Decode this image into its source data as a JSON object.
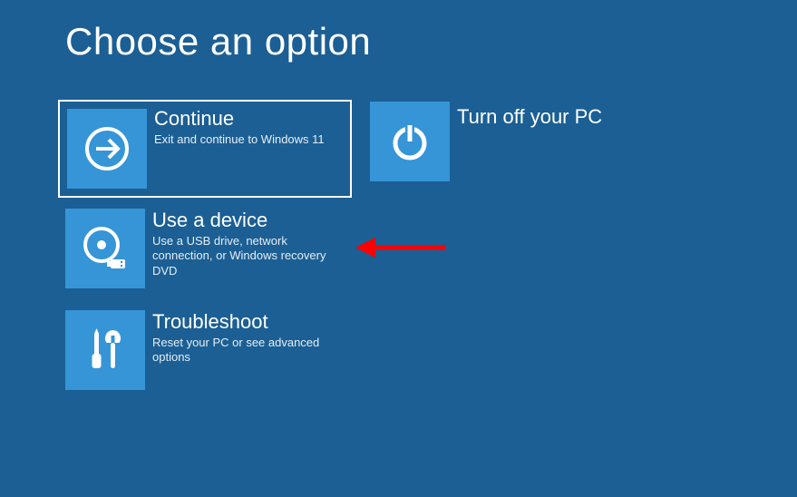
{
  "title": "Choose an option",
  "tiles": {
    "continue": {
      "title": "Continue",
      "description": "Exit and continue to Windows 11",
      "icon": "arrow-right-icon",
      "selected": true
    },
    "turnoff": {
      "title": "Turn off your PC",
      "icon": "power-icon"
    },
    "device": {
      "title": "Use a device",
      "description": "Use a USB drive, network connection, or Windows recovery DVD",
      "icon": "disc-usb-icon"
    },
    "troubleshoot": {
      "title": "Troubleshoot",
      "description": "Reset your PC or see advanced options",
      "icon": "tools-icon"
    }
  },
  "annotation": {
    "type": "red-arrow",
    "color": "#ff0000",
    "points_to": "device"
  },
  "colors": {
    "background": "#1b5f94",
    "tile_icon": "#3595d7",
    "text": "#ffffff"
  }
}
